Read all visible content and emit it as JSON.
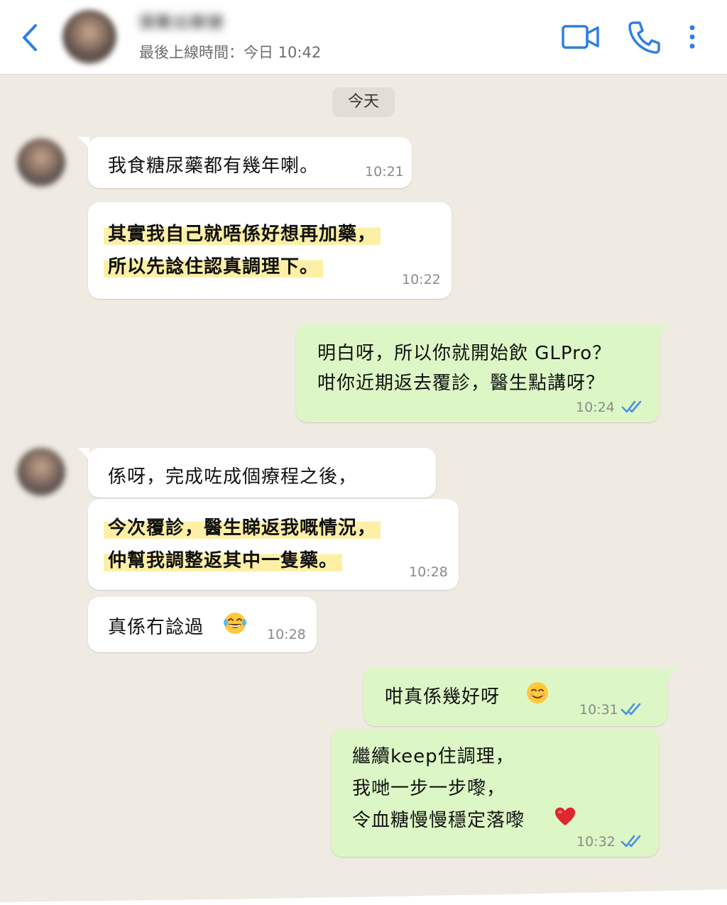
{
  "header": {
    "contact_name": "張聚出賬號",
    "last_seen": "最後上線時間：今日 10:42"
  },
  "icons": {
    "back": "chevron-left-icon",
    "video": "video-camera-icon",
    "phone": "phone-icon",
    "more": "more-vertical-icon"
  },
  "colors": {
    "accent": "#2f7fe4",
    "incoming_bubble": "#ffffff",
    "outgoing_bubble": "#dcf7c5",
    "highlight": "#fdf0a6",
    "read_tick": "#4a90e2"
  },
  "chat": {
    "day_label": "今天",
    "messages": [
      {
        "lines": [
          "我食糖尿藥都有幾年喇。"
        ],
        "time": "10:21"
      },
      {
        "lines": [
          "其實我自己就唔係好想再加藥，",
          "所以先諗住認真調理下。"
        ],
        "time": "10:22"
      },
      {
        "lines": [
          "明白呀，所以你就開始飲 GLPro？",
          "咁你近期返去覆診，醫生點講呀？"
        ],
        "time": "10:24"
      },
      {
        "lines": [
          "係呀，完成咗成個療程之後，"
        ]
      },
      {
        "lines": [
          "今次覆診，醫生睇返我嘅情況，",
          "仲幫我調整返其中一隻藥。"
        ],
        "time": "10:28"
      },
      {
        "lines": [
          "真係冇諗過"
        ],
        "time": "10:28"
      },
      {
        "lines": [
          "咁真係幾好呀"
        ],
        "time": "10:31"
      },
      {
        "lines": [
          "繼續keep住調理，",
          "我哋一步一步嚟，",
          "令血糖慢慢穩定落嚟"
        ],
        "time": "10:32"
      }
    ]
  }
}
